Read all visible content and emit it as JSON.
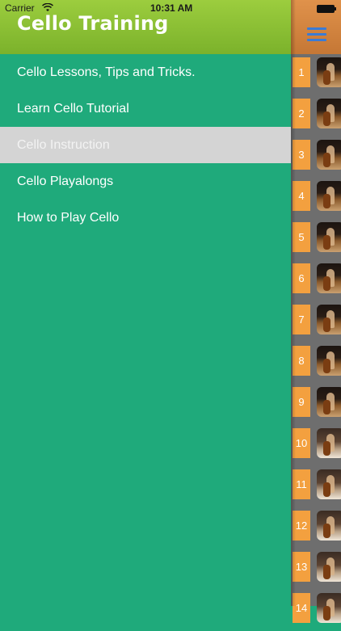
{
  "status_bar": {
    "carrier": "Carrier",
    "time": "10:31 AM"
  },
  "drawer": {
    "title": "Cello Training",
    "items": [
      {
        "label": "Cello Lessons, Tips and Tricks.",
        "selected": false
      },
      {
        "label": "Learn Cello Tutorial",
        "selected": false
      },
      {
        "label": "Cello Instruction",
        "selected": true
      },
      {
        "label": "Cello Playalongs",
        "selected": false
      },
      {
        "label": "How to Play Cello",
        "selected": false
      }
    ]
  },
  "main": {
    "menu_icon": "hamburger-icon",
    "videos": [
      {
        "number": "1"
      },
      {
        "number": "2"
      },
      {
        "number": "3"
      },
      {
        "number": "4"
      },
      {
        "number": "5"
      },
      {
        "number": "6"
      },
      {
        "number": "7"
      },
      {
        "number": "8"
      },
      {
        "number": "9"
      },
      {
        "number": "10"
      },
      {
        "number": "11"
      },
      {
        "number": "12"
      },
      {
        "number": "13"
      },
      {
        "number": "14"
      }
    ]
  },
  "colors": {
    "drawer_bg": "#1faa7b",
    "header_green": "#8cc034",
    "header_orange": "#d98640",
    "badge_orange": "#f3a03f",
    "selected_item": "#d4d4d4"
  }
}
